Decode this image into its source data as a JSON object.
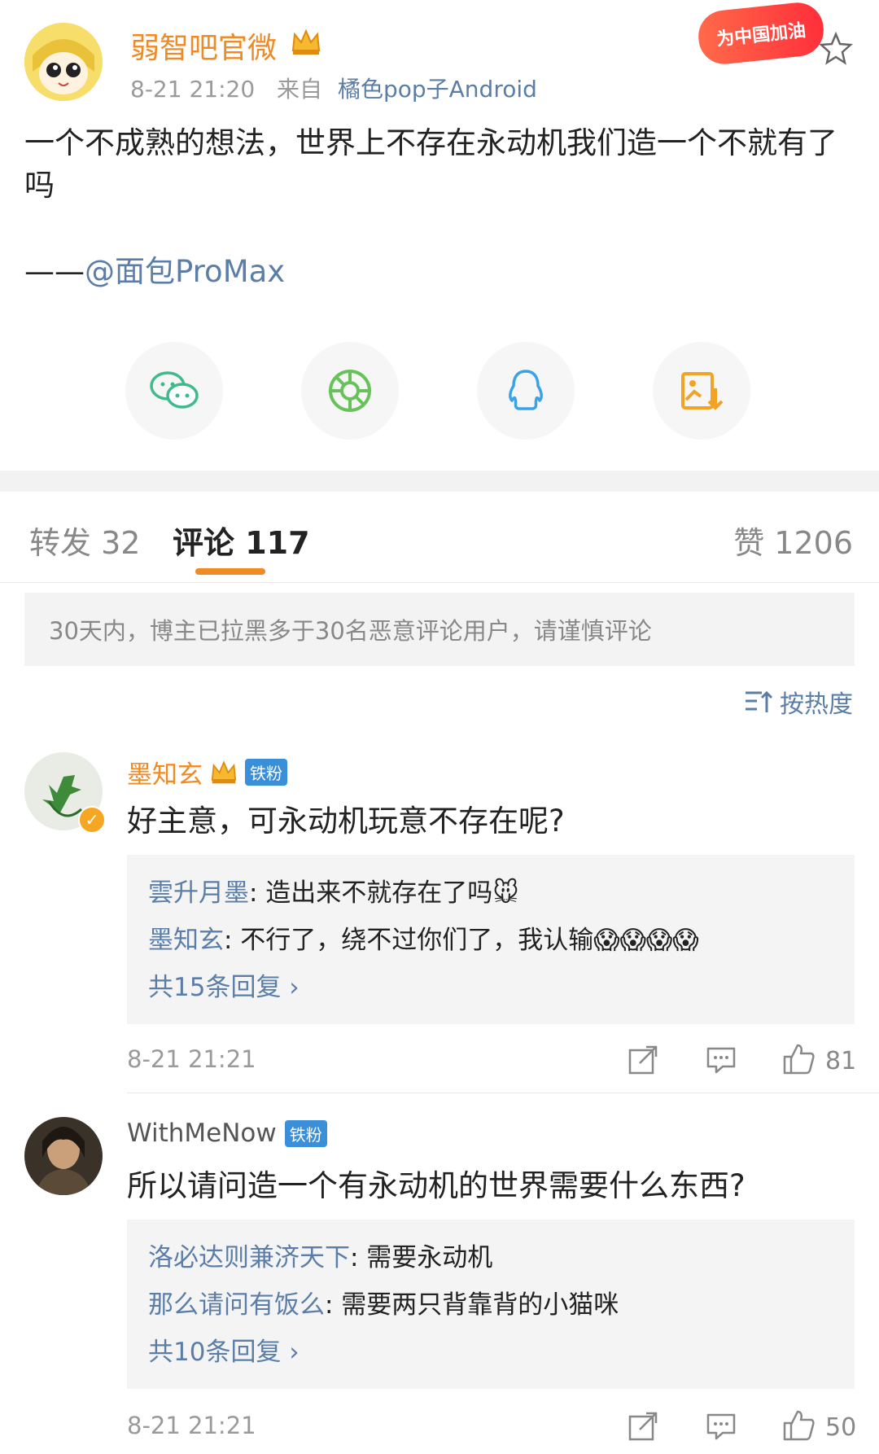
{
  "post": {
    "author": "弱智吧官微",
    "time": "8-21 21:20",
    "source_prefix": "来自",
    "source": "橘色pop子Android",
    "badge": "为中国加油",
    "text": "一个不成熟的想法，世界上不存在永动机我们造一个不就有了吗",
    "sig_dash": "——",
    "sig_mention": "@面包ProMax"
  },
  "share": [
    "wechat-icon",
    "moments-icon",
    "qq-icon",
    "save-image-icon"
  ],
  "tabs": {
    "repost": "转发 32",
    "comment": "评论 117",
    "like": "赞 1206"
  },
  "notice": "30天内，博主已拉黑多于30名恶意评论用户，请谨慎评论",
  "sort": "按热度",
  "colors": {
    "accent": "#f08a24",
    "link": "#5b7ea8",
    "fan_tag": "#3a8fd8"
  },
  "comments": [
    {
      "name": "墨知玄",
      "tag": "铁粉",
      "text": "好主意，可永动机玩意不存在呢?",
      "replies": [
        {
          "name": "雲升月墨",
          "text": ": 造出来不就存在了吗🐭"
        },
        {
          "name": "墨知玄",
          "text": ": 不行了，绕不过你们了，我认输😱😱😱😱"
        }
      ],
      "more": "共15条回复 ›",
      "time": "8-21 21:21",
      "likes": "81"
    },
    {
      "name": "WithMeNow",
      "tag": "铁粉",
      "text": "所以请问造一个有永动机的世界需要什么东西?",
      "replies": [
        {
          "name": "洛必达则兼济天下",
          "text": ": 需要永动机"
        },
        {
          "name": "那么请问有饭么",
          "text": ": 需要两只背靠背的小猫咪"
        }
      ],
      "more": "共10条回复 ›",
      "time": "8-21 21:21",
      "likes": "50"
    }
  ]
}
